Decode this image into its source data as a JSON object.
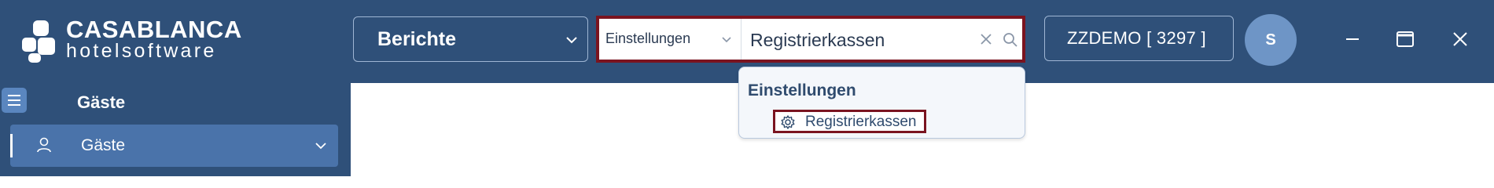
{
  "logo": {
    "line1": "CASABLANCA",
    "line2": "hotelsoftware"
  },
  "module_select": {
    "value": "Berichte"
  },
  "search": {
    "scope": "Einstellungen",
    "query": "Registrierkassen"
  },
  "dropdown": {
    "group": "Einstellungen",
    "results": [
      {
        "label": "Registrierkassen",
        "icon": "gear-icon"
      }
    ]
  },
  "client": {
    "label": "ZZDEMO [ 3297 ]"
  },
  "user": {
    "initial": "S"
  },
  "sidebar": {
    "section": "Gäste",
    "items": [
      {
        "label": "Gäste",
        "icon": "user-icon",
        "active": true
      }
    ]
  },
  "colors": {
    "header_bg": "#2f5079",
    "highlight_border": "#7a1420",
    "active_nav": "#4a73aa",
    "avatar": "#6e95c6"
  }
}
